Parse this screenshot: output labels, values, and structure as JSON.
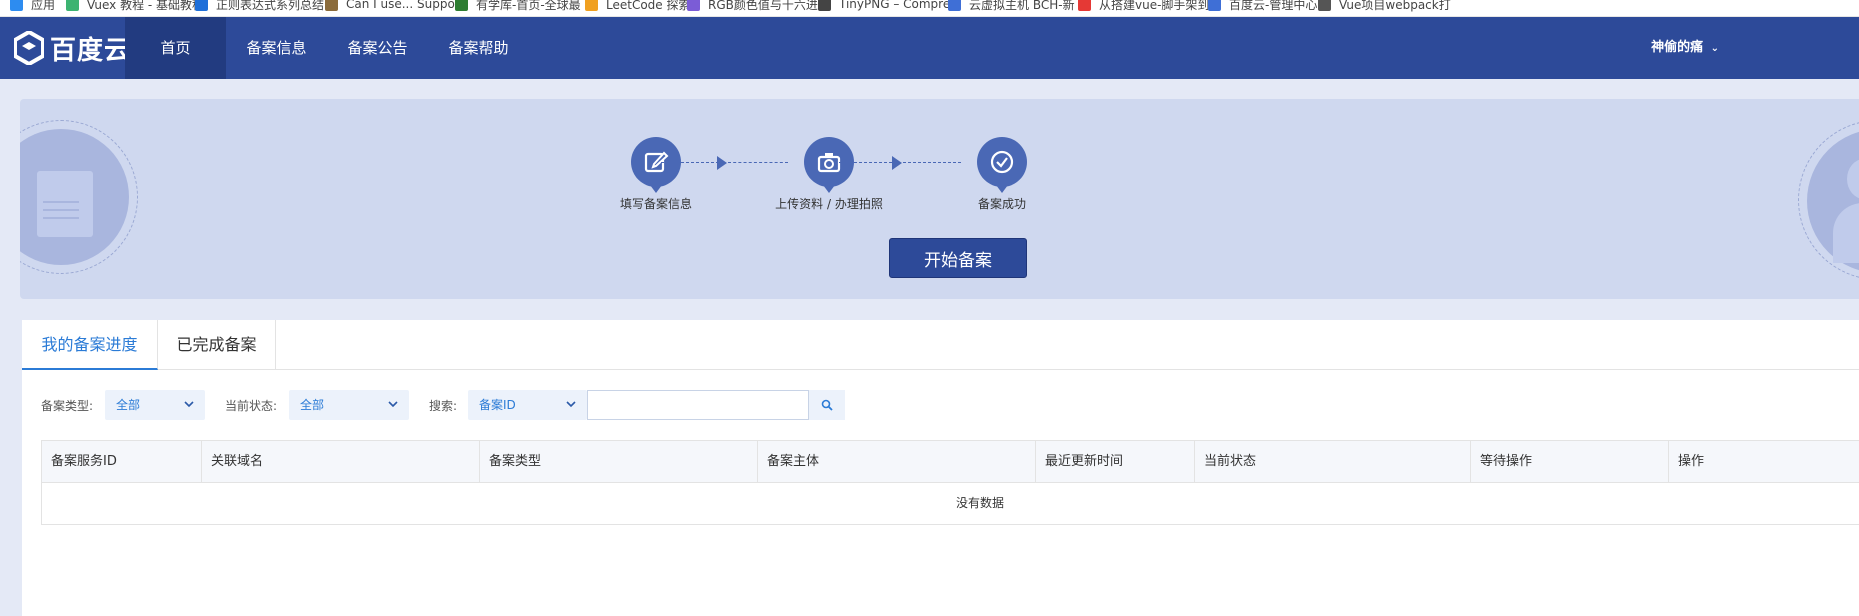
{
  "bookmarks": [
    {
      "label": "应用",
      "color": "#2d8cf0"
    },
    {
      "label": "Vuex 教程 - 基础教程",
      "color": "#3cb371"
    },
    {
      "label": "正则表达式系列总结",
      "color": "#1e6fd9"
    },
    {
      "label": "Can I use... Support",
      "color": "#8b6b3a"
    },
    {
      "label": "有学库-首页-全球最",
      "color": "#2e7d32"
    },
    {
      "label": "LeetCode 探索",
      "color": "#f0a020"
    },
    {
      "label": "RGB颜色值与十六进",
      "color": "#7b5cd6"
    },
    {
      "label": "TinyPNG – Compre",
      "color": "#444444"
    },
    {
      "label": "云虚拟主机 BCH-新",
      "color": "#3f6fd6"
    },
    {
      "label": "从搭建vue-脚手架到",
      "color": "#e53935"
    },
    {
      "label": "百度云-管理中心",
      "color": "#3f6fd6"
    },
    {
      "label": "Vue项目webpack打",
      "color": "#555555"
    }
  ],
  "header": {
    "logo_text": "百度云",
    "nav": [
      "首页",
      "备案信息",
      "备案公告",
      "备案帮助"
    ],
    "active_nav": "首页",
    "user": "神偷的痛"
  },
  "banner": {
    "steps": [
      {
        "label": "填写备案信息",
        "icon": "edit-icon"
      },
      {
        "label": "上传资料 / 办理拍照",
        "icon": "camera-icon"
      },
      {
        "label": "备案成功",
        "icon": "check-icon"
      }
    ],
    "start_button": "开始备案"
  },
  "tabs": [
    "我的备案进度",
    "已完成备案"
  ],
  "filters": {
    "type_label": "备案类型:",
    "type_value": "全部",
    "status_label": "当前状态:",
    "status_value": "全部",
    "search_label": "搜索:",
    "search_field": "备案ID",
    "search_value": ""
  },
  "table": {
    "columns": [
      "备案服务ID",
      "关联域名",
      "备案类型",
      "备案主体",
      "最近更新时间",
      "当前状态",
      "等待操作",
      "操作"
    ],
    "empty_text": "没有数据"
  },
  "colors": {
    "nav_bg": "#2d4a99",
    "accent": "#2b7bd6",
    "banner_bg": "#cfd8ef"
  }
}
